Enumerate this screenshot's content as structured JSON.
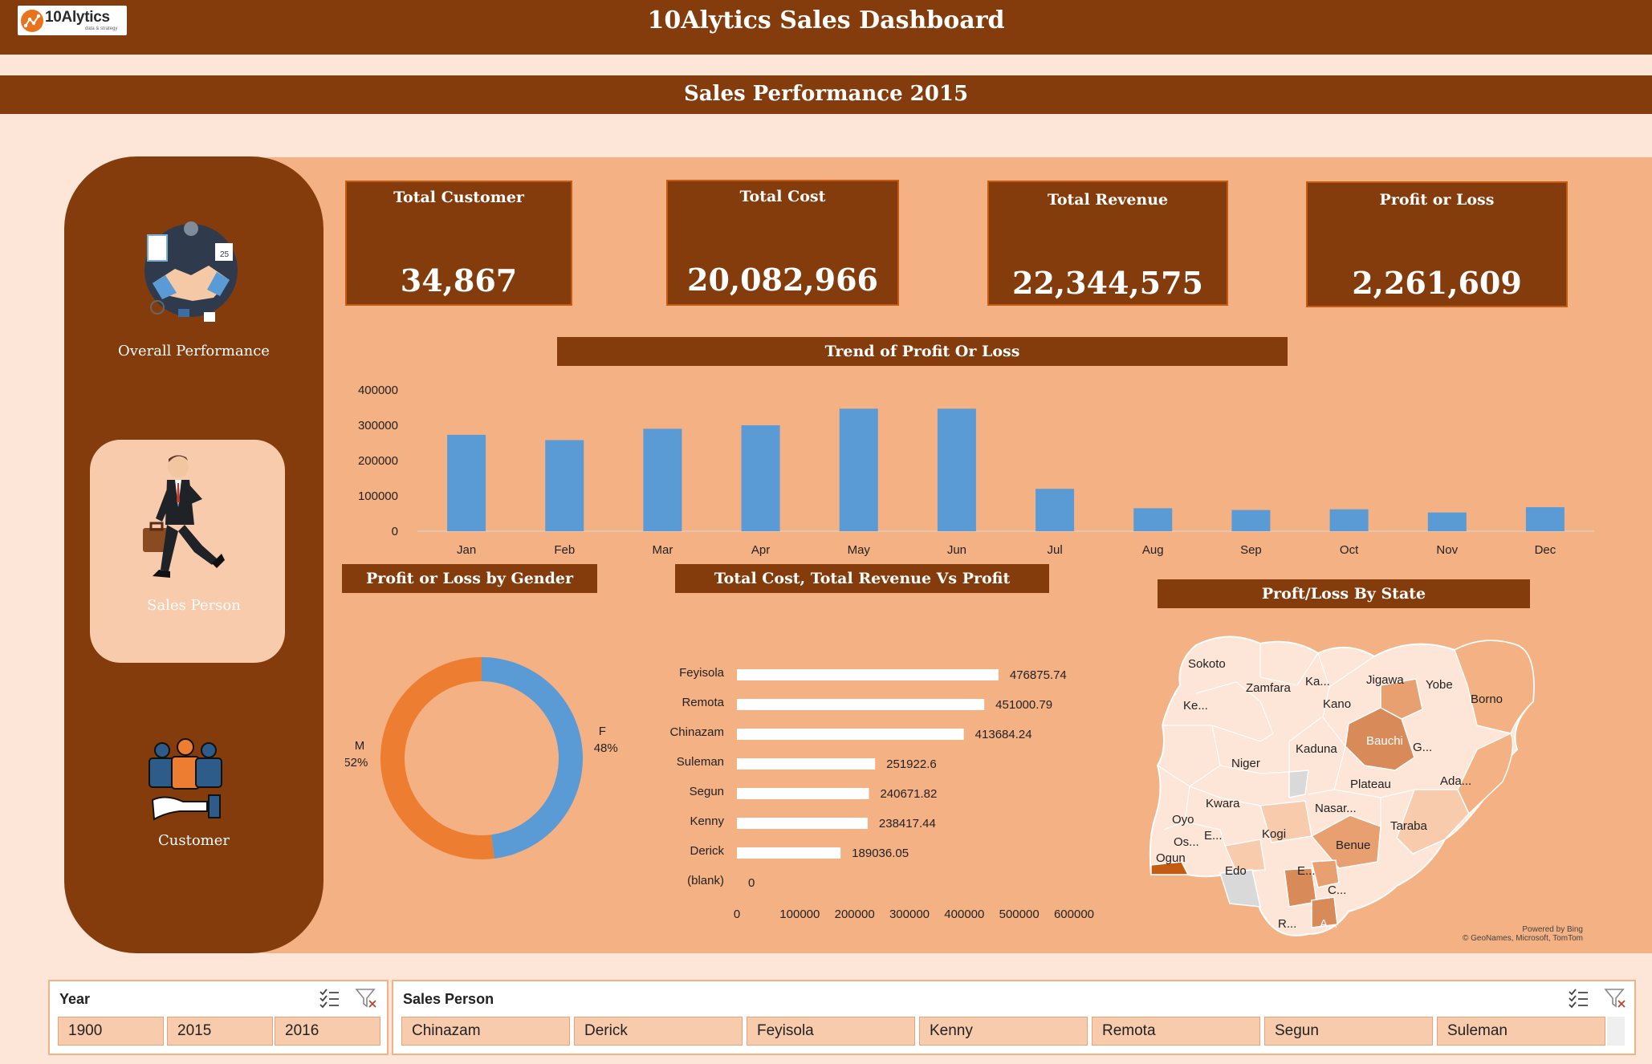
{
  "header": {
    "title": "10Alytics Sales Dashboard",
    "logo_text": "10Alytics",
    "logo_sub": "data & strategy"
  },
  "section": {
    "title": "Sales Performance 2015"
  },
  "nav": {
    "items": [
      {
        "label": "Overall Performance",
        "icon": "handshake-icon"
      },
      {
        "label": "Sales Person",
        "icon": "businessman-icon",
        "active": true
      },
      {
        "label": "Customer",
        "icon": "customers-hand-icon"
      }
    ]
  },
  "kpis": [
    {
      "title": "Total Customer",
      "value": "34,867"
    },
    {
      "title": "Total Cost",
      "value": "20,082,966"
    },
    {
      "title": "Total Revenue",
      "value": "22,344,575"
    },
    {
      "title": "Profit or Loss",
      "value": "2,261,609"
    }
  ],
  "chart_data": [
    {
      "type": "bar",
      "title": "Trend of Profit Or Loss",
      "categories": [
        "Jan",
        "Feb",
        "Mar",
        "Apr",
        "May",
        "Jun",
        "Jul",
        "Aug",
        "Sep",
        "Oct",
        "Nov",
        "Dec"
      ],
      "values": [
        273000,
        258000,
        290000,
        300000,
        347000,
        347000,
        120000,
        65000,
        60000,
        62000,
        53000,
        68000
      ],
      "ylim": [
        0,
        400000
      ],
      "yticks": [
        "0",
        "100000",
        "200000",
        "300000",
        "400000"
      ],
      "color": "#5b9bd5",
      "grid": false
    },
    {
      "type": "pie",
      "title": "Profit or Loss by Gender",
      "donut": true,
      "slices": [
        {
          "name": "F",
          "value": 48,
          "label": "48%",
          "color": "#5b9bd5"
        },
        {
          "name": "M",
          "value": 52,
          "label": "52%",
          "color": "#ed7d31"
        }
      ]
    },
    {
      "type": "bar",
      "orientation": "horizontal",
      "title": "Total Cost, Total Revenue Vs Profit",
      "categories": [
        "Feyisola",
        "Remota",
        "Chinazam",
        "Suleman",
        "Segun",
        "Kenny",
        "Derick",
        "(blank)"
      ],
      "values": [
        476875.74,
        451000.79,
        413684.24,
        251922.6,
        240671.82,
        238417.44,
        189036.05,
        0
      ],
      "labels": [
        "476875.74",
        "451000.79",
        "413684.24",
        "251922.6",
        "240671.82",
        "238417.44",
        "189036.05",
        "0"
      ],
      "xlim": [
        0,
        600000
      ],
      "xticks": [
        "0",
        "100000",
        "200000",
        "300000",
        "400000",
        "500000",
        "600000"
      ],
      "color": "#ffffff"
    }
  ],
  "map": {
    "title": "Proft/Loss By State",
    "labels": [
      "Sokoto",
      "Ke...",
      "Zamfara",
      "Ka...",
      "Jigawa",
      "Yobe",
      "Borno",
      "Kano",
      "Bauchi",
      "G...",
      "Niger",
      "Kaduna",
      "Ada...",
      "Plateau",
      "Kwara",
      "Nasar...",
      "Taraba",
      "Oyo",
      "Os...",
      "E...",
      "Kogi",
      "Benue",
      "Ogun",
      "Edo",
      "E...",
      "C...",
      "R...",
      "A..."
    ],
    "credit_line1": "Powered by Bing",
    "credit_line2": "© GeoNames, Microsoft, TomTom"
  },
  "slicers": {
    "year": {
      "title": "Year",
      "items": [
        "1900",
        "2015",
        "2016"
      ]
    },
    "sales_person": {
      "title": "Sales Person",
      "items": [
        "Chinazam",
        "Derick",
        "Feyisola",
        "Kenny",
        "Remota",
        "Segun",
        "Suleman"
      ]
    }
  }
}
